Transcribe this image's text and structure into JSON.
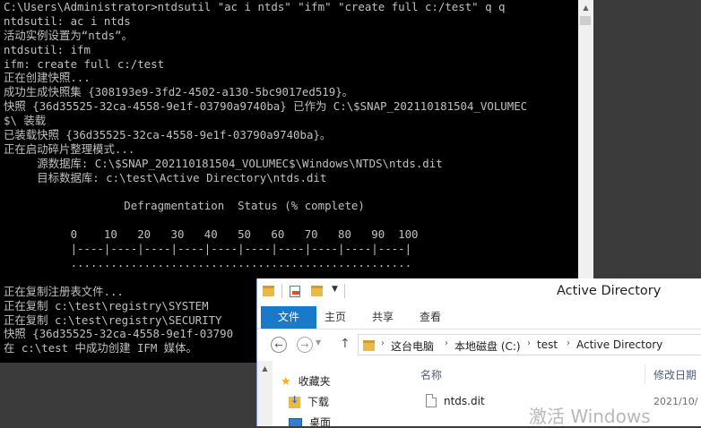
{
  "console": {
    "lines": [
      "C:\\Users\\Administrator>ntdsutil \"ac i ntds\" \"ifm\" \"create full c:/test\" q q",
      "ntdsutil: ac i ntds",
      "活动实例设置为“ntds”。",
      "ntdsutil: ifm",
      "ifm: create full c:/test",
      "正在创建快照...",
      "成功生成快照集 {308193e9-3fd2-4502-a130-5bc9017ed519}。",
      "快照 {36d35525-32ca-4558-9e1f-03790a9740ba} 已作为 C:\\$SNAP_202110181504_VOLUMEC",
      "$\\ 装载",
      "已装载快照 {36d35525-32ca-4558-9e1f-03790a9740ba}。",
      "正在启动碎片整理模式...",
      "     源数据库: C:\\$SNAP_202110181504_VOLUMEC$\\Windows\\NTDS\\ntds.dit",
      "     目标数据库: c:\\test\\Active Directory\\ntds.dit",
      "",
      "                  Defragmentation  Status (% complete)",
      "",
      "          0    10   20   30   40   50   60   70   80   90  100",
      "          |----|----|----|----|----|----|----|----|----|----|",
      "          ...................................................",
      "",
      "正在复制注册表文件...",
      "正在复制 c:\\test\\registry\\SYSTEM",
      "正在复制 c:\\test\\registry\\SECURITY",
      "快照 {36d35525-32ca-4558-9e1f-03790",
      "在 c:\\test 中成功创建 IFM 媒体。"
    ]
  },
  "explorer": {
    "title": "Active Directory",
    "ribbon_tabs": [
      "文件",
      "主页",
      "共享",
      "查看"
    ],
    "breadcrumb": [
      "这台电脑",
      "本地磁盘 (C:)",
      "test",
      "Active Directory"
    ],
    "nav_items": [
      {
        "label": "收藏夹",
        "icon": "star-icon"
      },
      {
        "label": "下载",
        "icon": "download-folder-icon"
      },
      {
        "label": "桌面",
        "icon": "desktop-icon"
      }
    ],
    "columns": {
      "name": "名称",
      "modified": "修改日期"
    },
    "files": [
      {
        "name": "ntds.dit",
        "modified": "2021/10/"
      }
    ]
  },
  "watermark": "激活 Windows",
  "colors": {
    "console_bg": "#000000",
    "console_fg": "#c0c0c0",
    "file_tab": "#1979ca"
  }
}
